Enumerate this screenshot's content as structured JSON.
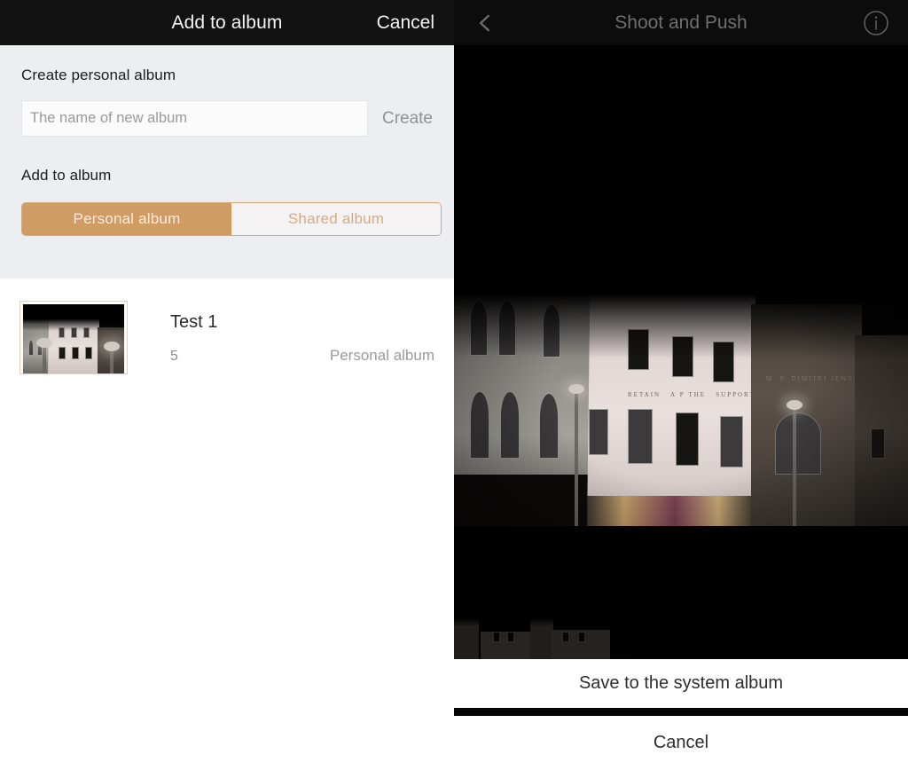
{
  "left": {
    "topbar": {
      "title": "Add to album",
      "cancel_label": "Cancel"
    },
    "create_section": {
      "heading": "Create personal album",
      "input_value": "",
      "input_placeholder": "The name of new album",
      "create_label": "Create"
    },
    "add_section": {
      "heading": "Add to album",
      "segments": [
        {
          "label": "Personal album",
          "active": true
        },
        {
          "label": "Shared album",
          "active": false
        }
      ]
    },
    "albums": [
      {
        "title": "Test 1",
        "count": "5",
        "type": "Personal album"
      }
    ]
  },
  "right": {
    "topbar": {
      "title": "Shoot and Push",
      "back_icon": "chevron-left-icon",
      "info_icon": "info-circle-icon"
    },
    "sheet": {
      "save_label": "Save to the system album",
      "cancel_label": "Cancel"
    }
  },
  "colors": {
    "accent": "#cf9c64",
    "accent_border": "#d5a878",
    "accent_text_inactive": "#d6ab80",
    "topbar_left_bg": "#121212",
    "topbar_right_bg": "#0c0c0c",
    "form_bg": "#eceef1",
    "photo_bg": "#000000",
    "sheet_bg": "#ffffff",
    "muted_text": "#9b9b9b"
  }
}
